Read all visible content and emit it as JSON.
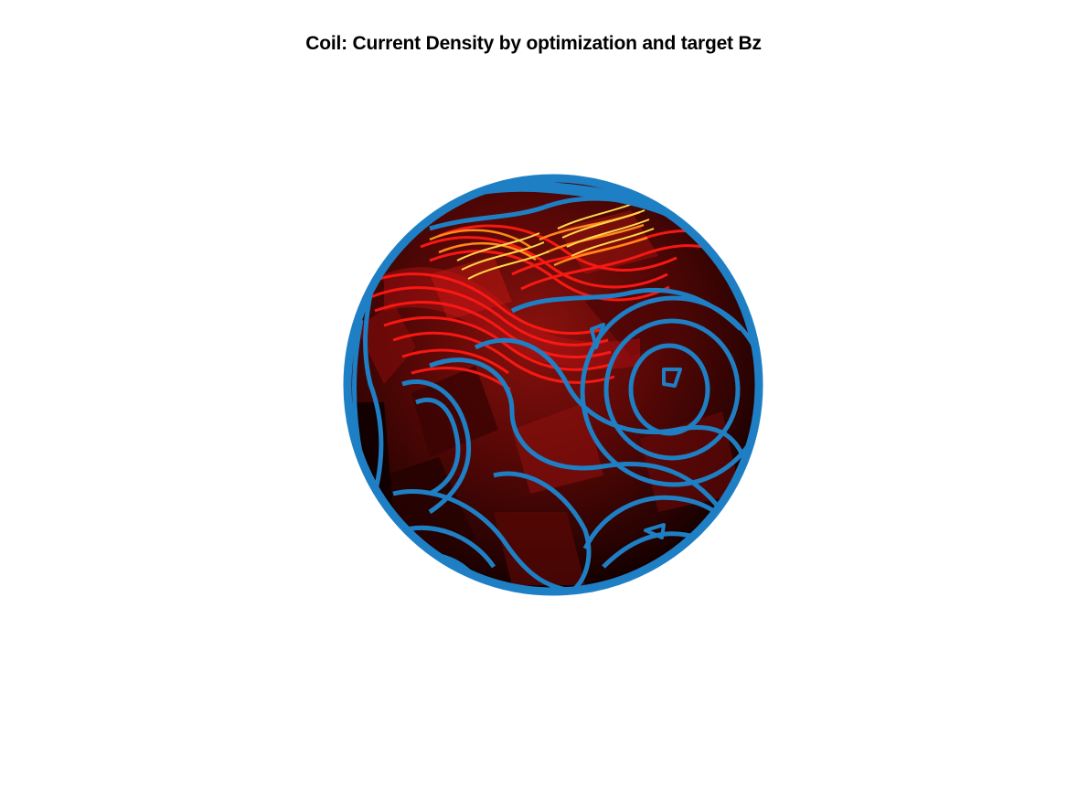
{
  "figure": {
    "title": "Coil: Current Density by optimization and target Bz"
  },
  "colors": {
    "background": "#ffffff",
    "sphere_dark": "#0a0000",
    "sphere_mid": "#6b0a08",
    "sphere_bright": "#e0161a",
    "contour_blue": "#1f7fc4",
    "contour_red": "#ff1a14",
    "contour_orange": "#ff8a1a",
    "contour_yellow": "#ffd84a",
    "title_color": "#000000"
  }
}
